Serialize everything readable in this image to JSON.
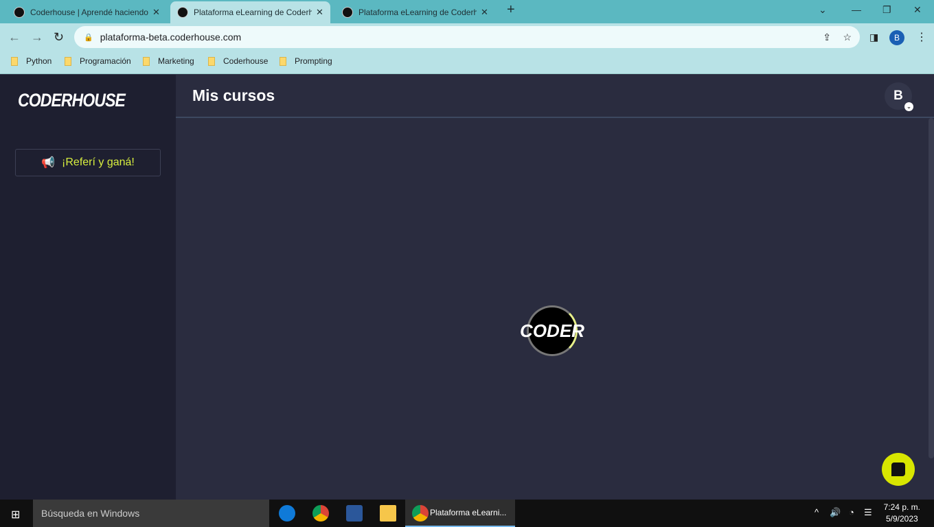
{
  "browser": {
    "tabs": [
      {
        "title": "Coderhouse | Aprendé haciendo"
      },
      {
        "title": "Plataforma eLearning de Coderhouse"
      },
      {
        "title": "Plataforma eLearning de Coderhouse"
      }
    ],
    "url": "plataforma-beta.coderhouse.com",
    "bookmarks": [
      "Python",
      "Programación",
      "Marketing",
      "Coderhouse",
      "Prompting"
    ],
    "profile_initial": "B"
  },
  "sidebar": {
    "logo": "CODERHOUSE",
    "refer_label": "¡Referí y ganá!"
  },
  "main": {
    "title": "Mis cursos",
    "avatar_initial": "B",
    "loader_text": "CODER"
  },
  "taskbar": {
    "search_placeholder": "Búsqueda en Windows",
    "running_app": "Plataforma eLearni...",
    "time": "7:24 p. m.",
    "date": "5/9/2023"
  }
}
